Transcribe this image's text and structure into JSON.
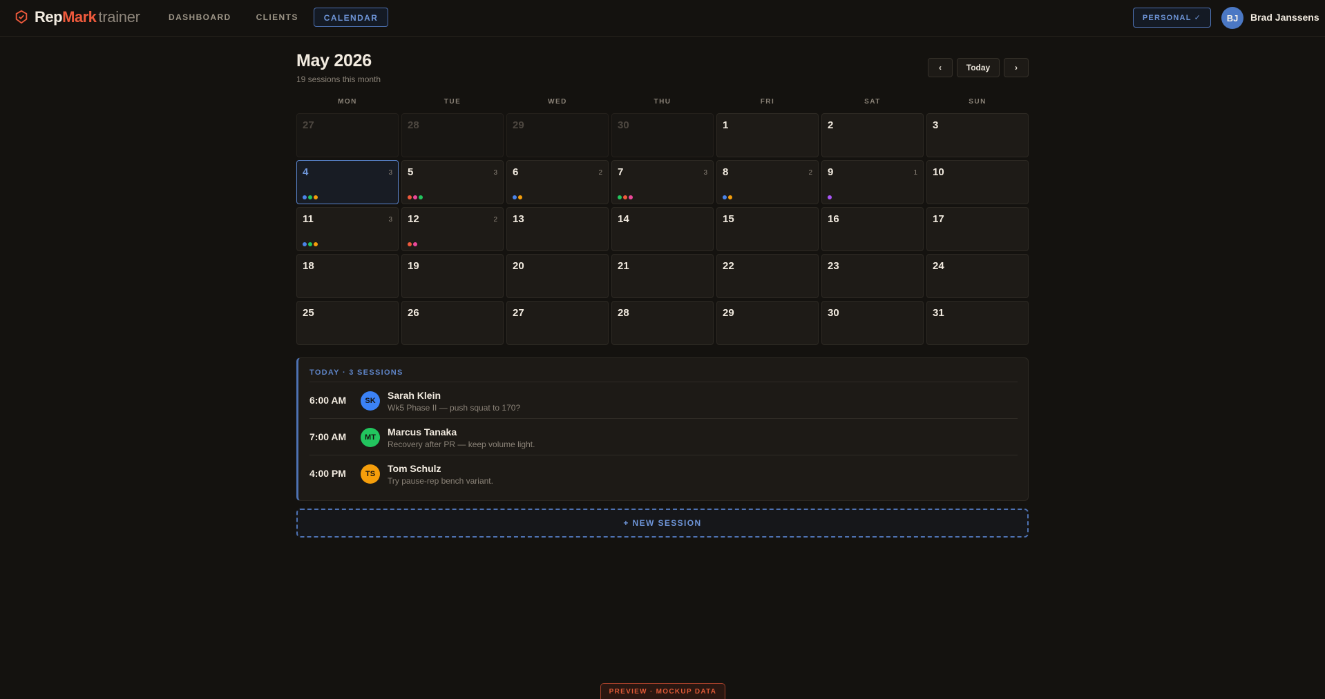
{
  "brand": {
    "part1": "Rep",
    "part2": "Mark",
    "part3": "trainer",
    "accent": "#ef5a3c"
  },
  "nav": [
    {
      "label": "DASHBOARD",
      "active": false
    },
    {
      "label": "CLIENTS",
      "active": false
    },
    {
      "label": "CALENDAR",
      "active": true
    }
  ],
  "topbar": {
    "mode_label": "PERSONAL ✓",
    "user_initials": "BJ",
    "user_name": "Brad Janssens"
  },
  "header": {
    "title": "May 2026",
    "subtitle": "19 sessions this month",
    "today_label": "Today",
    "prev_icon": "‹",
    "next_icon": "›"
  },
  "weekdays": [
    "MON",
    "TUE",
    "WED",
    "THU",
    "FRI",
    "SAT",
    "SUN"
  ],
  "days": [
    {
      "day": "27",
      "other": true
    },
    {
      "day": "28",
      "other": true
    },
    {
      "day": "29",
      "other": true
    },
    {
      "day": "30",
      "other": true
    },
    {
      "day": "1"
    },
    {
      "day": "2"
    },
    {
      "day": "3"
    },
    {
      "day": "4",
      "selected": true,
      "count": "3",
      "dots": [
        "#4b83e8",
        "#22c55e",
        "#f59e0b"
      ]
    },
    {
      "day": "5",
      "count": "3",
      "dots": [
        "#ef5a3c",
        "#ec4899",
        "#22c55e"
      ]
    },
    {
      "day": "6",
      "count": "2",
      "dots": [
        "#4b83e8",
        "#f59e0b"
      ]
    },
    {
      "day": "7",
      "count": "3",
      "dots": [
        "#22c55e",
        "#ef5a3c",
        "#ec4899"
      ]
    },
    {
      "day": "8",
      "count": "2",
      "dots": [
        "#4b83e8",
        "#f59e0b"
      ]
    },
    {
      "day": "9",
      "count": "1",
      "dots": [
        "#a855f7"
      ]
    },
    {
      "day": "10"
    },
    {
      "day": "11",
      "count": "3",
      "dots": [
        "#4b83e8",
        "#22c55e",
        "#f59e0b"
      ]
    },
    {
      "day": "12",
      "count": "2",
      "dots": [
        "#ef5a3c",
        "#ec4899"
      ]
    },
    {
      "day": "13"
    },
    {
      "day": "14"
    },
    {
      "day": "15"
    },
    {
      "day": "16"
    },
    {
      "day": "17"
    },
    {
      "day": "18"
    },
    {
      "day": "19"
    },
    {
      "day": "20"
    },
    {
      "day": "21"
    },
    {
      "day": "22"
    },
    {
      "day": "23"
    },
    {
      "day": "24"
    },
    {
      "day": "25"
    },
    {
      "day": "26"
    },
    {
      "day": "27"
    },
    {
      "day": "28"
    },
    {
      "day": "29"
    },
    {
      "day": "30"
    },
    {
      "day": "31"
    }
  ],
  "today": {
    "heading": "TODAY · 3 SESSIONS",
    "sessions": [
      {
        "time": "6:00 AM",
        "initials": "SK",
        "color": "#3b82f6",
        "name": "Sarah Klein",
        "note": "Wk5 Phase II — push squat to 170?"
      },
      {
        "time": "7:00 AM",
        "initials": "MT",
        "color": "#22c55e",
        "name": "Marcus Tanaka",
        "note": "Recovery after PR — keep volume light."
      },
      {
        "time": "4:00 PM",
        "initials": "TS",
        "color": "#f59e0b",
        "name": "Tom Schulz",
        "note": "Try pause-rep bench variant."
      }
    ]
  },
  "new_session_label": "+ NEW SESSION",
  "preview_label": "PREVIEW · MOCKUP DATA"
}
